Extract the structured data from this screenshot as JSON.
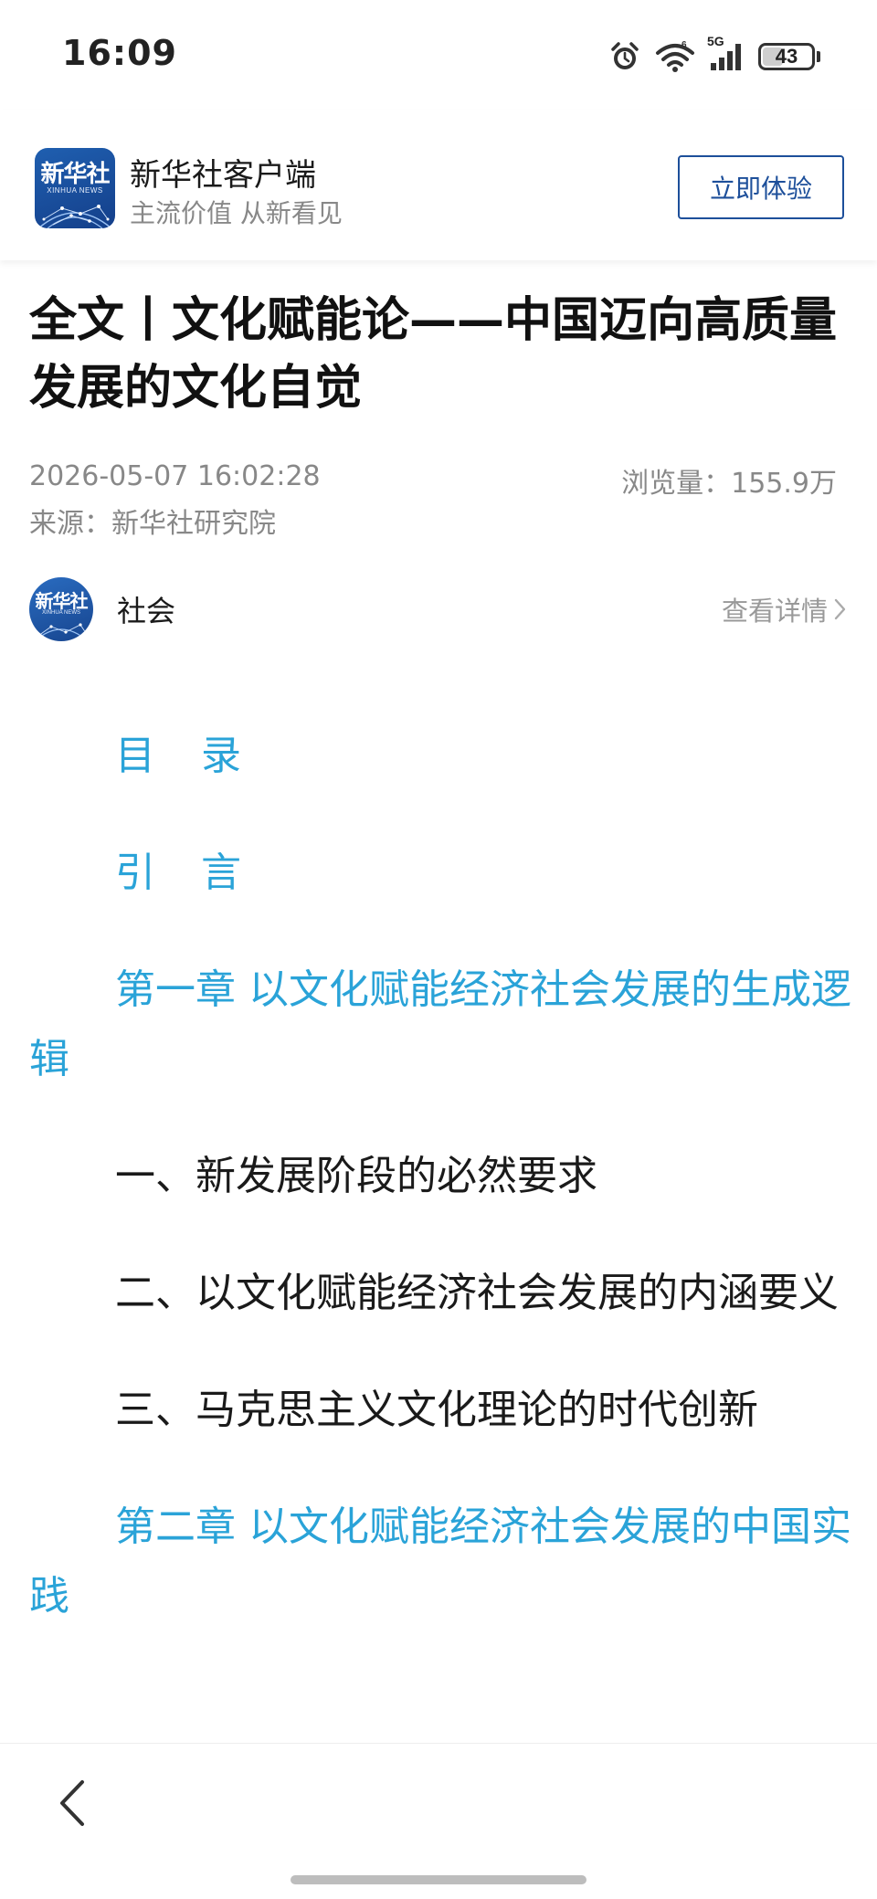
{
  "status_bar": {
    "time": "16:09",
    "signal_tag": "5G",
    "battery_level": "43",
    "battery_fraction": 0.43
  },
  "app_header": {
    "logo_text": "新华社",
    "logo_sub": "XINHUA NEWS",
    "app_name": "新华社客户端",
    "slogan": "主流价值 从新看见",
    "cta_label": "立即体验",
    "brand_color": "#1d4f9a"
  },
  "article": {
    "title": "全文丨文化赋能论——中国迈向高质量发展的文化自觉",
    "date": "2026-05-07 16:02:28",
    "views": "浏览量：155.9万",
    "source": "来源：新华社研究院"
  },
  "channel": {
    "avatar_text": "新华社",
    "avatar_sub": "XINHUA NEWS",
    "name": "社会",
    "details_label": "查看详情"
  },
  "toc": {
    "link_color": "#2aa3d8",
    "items": [
      {
        "text": "目 录",
        "type": "link"
      },
      {
        "text": "引 言",
        "type": "link"
      },
      {
        "text": "第一章 以文化赋能经济社会发展的生成逻辑",
        "type": "link"
      },
      {
        "text": "一、新发展阶段的必然要求",
        "type": "plain"
      },
      {
        "text": "二、以文化赋能经济社会发展的内涵要义",
        "type": "plain"
      },
      {
        "text": "三、马克思主义文化理论的时代创新",
        "type": "plain"
      },
      {
        "text": "第二章 以文化赋能经济社会发展的中国实践",
        "type": "link"
      }
    ]
  },
  "icons": {
    "alarm": "alarm-icon",
    "wifi": "wifi-icon",
    "signal": "cellular-signal-icon",
    "battery": "battery-icon",
    "chevron": "chevron-right-icon",
    "back": "back-arrow-icon"
  }
}
